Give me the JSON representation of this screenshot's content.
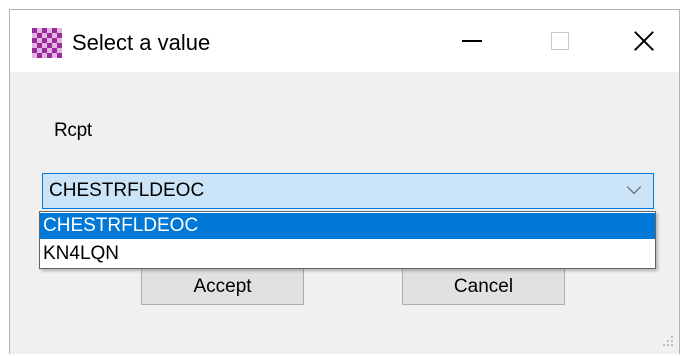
{
  "window": {
    "title": "Select a value",
    "icon": "app-checker-icon",
    "controls": {
      "minimize": "minimize-icon",
      "maximize": "maximize-icon",
      "close": "close-icon"
    }
  },
  "form": {
    "label": "Rcpt",
    "selected_value": "CHESTRFLDEOC",
    "options": [
      "CHESTRFLDEOC",
      "KN4LQN"
    ],
    "highlighted_option": "CHESTRFLDEOC"
  },
  "buttons": {
    "accept_label": "Accept",
    "cancel_label": "Cancel"
  },
  "colors": {
    "selection": "#0078d7",
    "combo_background": "#cce4f7",
    "window_background": "#f0f0f0"
  }
}
